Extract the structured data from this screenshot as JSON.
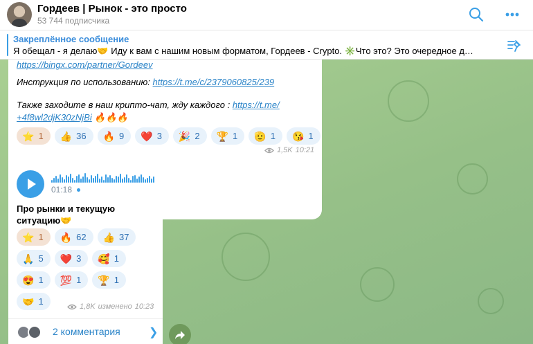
{
  "header": {
    "title": "Гордеев | Рынок - это просто",
    "subscribers": "53 744 подписчика"
  },
  "pinned": {
    "title": "Закреплённое сообщение",
    "text": "Я обещал - я делаю🤝 Иду к вам с нашим новым форматом, Гордеев - Crypto. ✳️Что это? Это очередное д…"
  },
  "message1": {
    "link_cut": "https://bingx.com/partner/Gordeev",
    "instr_label": "Инструкция по использованию: ",
    "instr_link": "https://t.me/c/2379060825/239",
    "chat_text": "Также заходите в наш крипто-чат, жду каждого : ",
    "chat_link_1": "https://t.me/",
    "chat_link_2": "+4f8wl2djK30zNjBi",
    "chat_fires": " 🔥🔥🔥",
    "reactions": [
      {
        "emoji": "⭐",
        "count": "1",
        "active": true
      },
      {
        "emoji": "👍",
        "count": "36"
      },
      {
        "emoji": "🔥",
        "count": "9"
      },
      {
        "emoji": "❤️",
        "count": "3"
      },
      {
        "emoji": "🎉",
        "count": "2"
      },
      {
        "emoji": "🏆",
        "count": "1"
      },
      {
        "emoji": "🫡",
        "count": "1"
      },
      {
        "emoji": "😘",
        "count": "1"
      }
    ],
    "views": "1,5K",
    "time": "10:21"
  },
  "message2": {
    "duration": "01:18",
    "caption": "Про рынки и текущую ситуацию🤝",
    "reactions": [
      {
        "emoji": "⭐",
        "count": "1",
        "active": true
      },
      {
        "emoji": "🔥",
        "count": "62"
      },
      {
        "emoji": "👍",
        "count": "37"
      },
      {
        "emoji": "🙏",
        "count": "5"
      },
      {
        "emoji": "❤️",
        "count": "3"
      },
      {
        "emoji": "🥰",
        "count": "1"
      },
      {
        "emoji": "😍",
        "count": "1"
      },
      {
        "emoji": "💯",
        "count": "1"
      },
      {
        "emoji": "🏆",
        "count": "1"
      },
      {
        "emoji": "🤝",
        "count": "1"
      }
    ],
    "views": "1,8K",
    "edited": "изменено",
    "time": "10:23",
    "comments": "2 комментария"
  },
  "colors": {
    "accent": "#3a9fe6",
    "link": "#2b84c8",
    "chat_bg": "#9fc58c"
  },
  "icons": [
    "search-icon",
    "more-icon",
    "pin-list-icon",
    "play-icon",
    "views-icon",
    "forward-icon",
    "chevron-right-icon"
  ]
}
